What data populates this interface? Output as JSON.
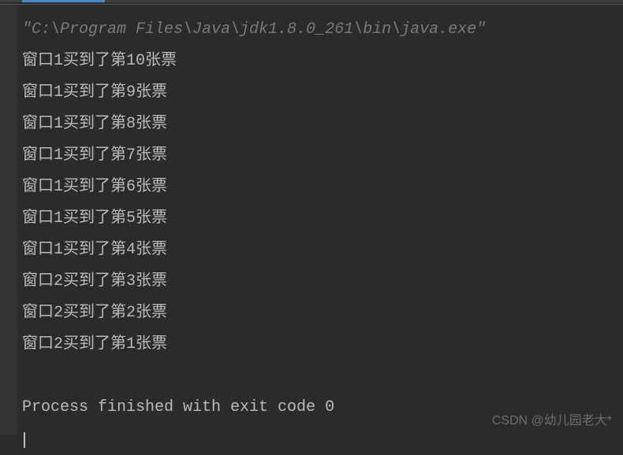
{
  "command_line": "\"C:\\Program Files\\Java\\jdk1.8.0_261\\bin\\java.exe\"",
  "output_lines": [
    "窗口1买到了第10张票",
    "窗口1买到了第9张票",
    "窗口1买到了第8张票",
    "窗口1买到了第7张票",
    "窗口1买到了第6张票",
    "窗口1买到了第5张票",
    "窗口1买到了第4张票",
    "窗口2买到了第3张票",
    "窗口2买到了第2张票",
    "窗口2买到了第1张票"
  ],
  "exit_message": "Process finished with exit code 0",
  "watermark": "CSDN @幼儿园老大*"
}
